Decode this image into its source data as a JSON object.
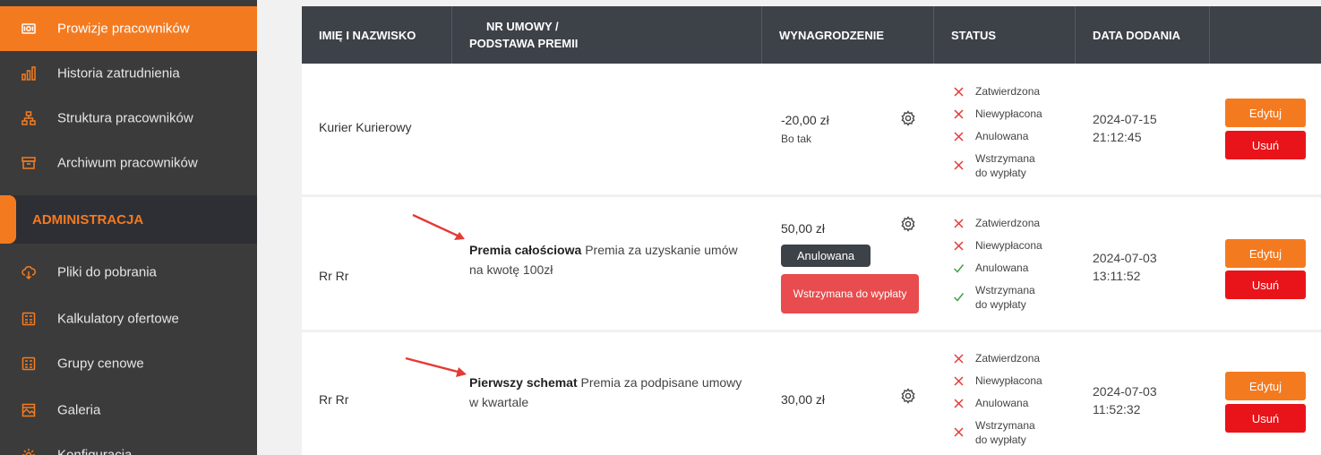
{
  "sidebar": {
    "items_top": [
      {
        "label": "Prowizje pracowników",
        "icon": "money-icon",
        "active": true
      },
      {
        "label": "Historia zatrudnienia",
        "icon": "bar-chart-icon"
      },
      {
        "label": "Struktura pracowników",
        "icon": "org-chart-icon"
      },
      {
        "label": "Archiwum pracowników",
        "icon": "archive-icon"
      }
    ],
    "section": "ADMINISTRACJA",
    "items_admin": [
      {
        "label": "Pliki do pobrania",
        "icon": "cloud-download-icon"
      },
      {
        "label": "Kalkulatory ofertowe",
        "icon": "calculator-icon"
      },
      {
        "label": "Grupy cenowe",
        "icon": "calculator-icon"
      },
      {
        "label": "Galeria",
        "icon": "gallery-icon"
      },
      {
        "label": "Konfiguracja",
        "icon": "gear-icon"
      }
    ]
  },
  "table": {
    "headers": [
      "IMIĘ I NAZWISKO",
      "NR UMOWY /",
      "PODSTAWA PREMII",
      "WYNAGRODZENIE",
      "STATUS",
      "DATA DODANIA"
    ],
    "rows": [
      {
        "name": "Kurier Kurierowy",
        "contract_bold": "",
        "contract_text": "",
        "salary": "-20,00 zł",
        "salary_note": "Bo tak",
        "statuses": [
          {
            "label": "Zatwierdzona",
            "ok": false
          },
          {
            "label": "Niewypłacona",
            "ok": false
          },
          {
            "label": "Anulowana",
            "ok": false
          },
          {
            "label": "Wstrzymana do wypłaty",
            "ok": false
          }
        ],
        "date": "2024-07-15",
        "time": "21:12:45"
      },
      {
        "name": "Rr Rr",
        "contract_bold": "Premia całościowa",
        "contract_text": "Premia za uzyskanie umów na kwotę 100zł",
        "salary": "50,00 zł",
        "badge_dark": "Anulowana",
        "badge_red": "Wstrzymana do wypłaty",
        "statuses": [
          {
            "label": "Zatwierdzona",
            "ok": false
          },
          {
            "label": "Niewypłacona",
            "ok": false
          },
          {
            "label": "Anulowana",
            "ok": true
          },
          {
            "label": "Wstrzymana do wypłaty",
            "ok": true
          }
        ],
        "date": "2024-07-03",
        "time": "13:11:52"
      },
      {
        "name": "Rr Rr",
        "contract_bold": "Pierwszy schemat",
        "contract_text": "Premia za podpisane umowy w kwartale",
        "salary": "30,00 zł",
        "statuses": [
          {
            "label": "Zatwierdzona",
            "ok": false
          },
          {
            "label": "Niewypłacona",
            "ok": false
          },
          {
            "label": "Anulowana",
            "ok": false
          },
          {
            "label": "Wstrzymana do wypłaty",
            "ok": false
          }
        ],
        "date": "2024-07-03",
        "time": "11:52:32"
      }
    ],
    "edit_label": "Edytuj",
    "delete_label": "Usuń"
  },
  "colors": {
    "accent": "#f47a20",
    "sidebar": "#3b3b3b",
    "header": "#3d4148",
    "danger": "#e8141a",
    "arrow": "#e53935"
  }
}
